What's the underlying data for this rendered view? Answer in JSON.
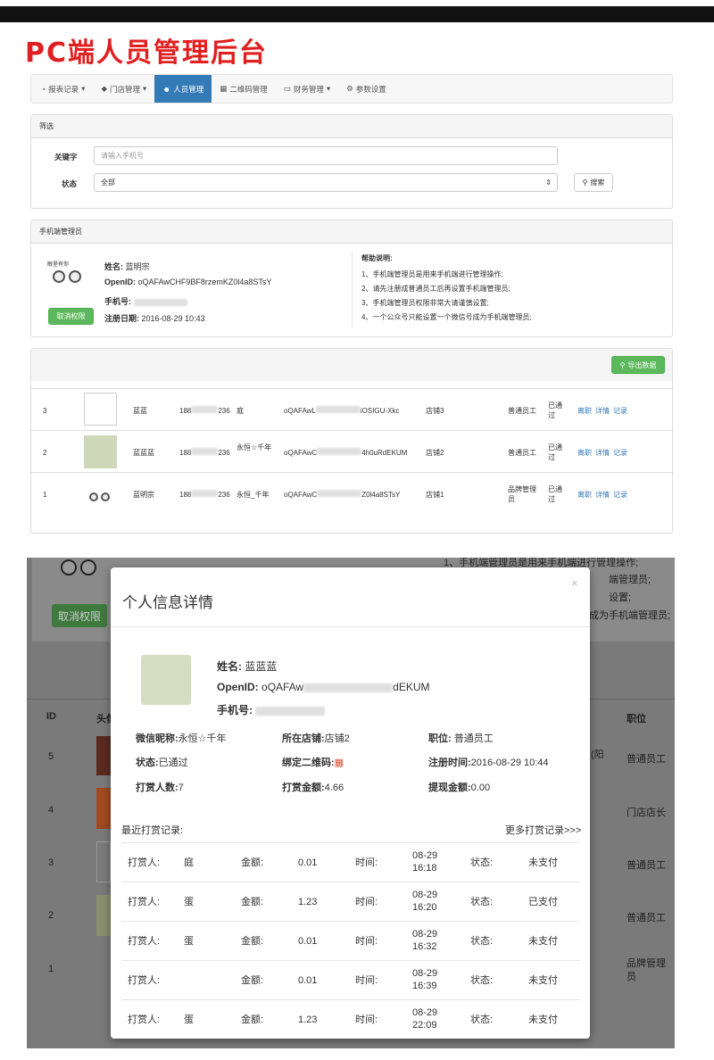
{
  "heading": "PC端人员管理后台",
  "nav": {
    "items": [
      {
        "label": "报表记录",
        "caret": "▾",
        "icon": "chart-icon"
      },
      {
        "label": "门店管理",
        "caret": "▾",
        "icon": "tag-icon"
      },
      {
        "label": "人员管理",
        "caret": "",
        "icon": "users-icon",
        "active": true
      },
      {
        "label": "二维码管理",
        "caret": "",
        "icon": "qrcode-icon"
      },
      {
        "label": "财务管理",
        "caret": "▾",
        "icon": "money-icon"
      },
      {
        "label": "参数设置",
        "caret": "",
        "icon": "gear-icon"
      }
    ]
  },
  "filter": {
    "title": "筛选",
    "keyword_label": "关键字",
    "keyword_placeholder": "请输入手机号",
    "status_label": "状态",
    "status_value": "全部",
    "search_button": "搜索"
  },
  "manager": {
    "title": "手机端管理员",
    "avatar_caption": "眼里有你",
    "cancel_button": "取消权限",
    "name_label": "姓名:",
    "name": "蓝明宗",
    "openid_label": "OpenID:",
    "openid": "oQAFAwCHF9BF8rzemKZ0l4a8STsY",
    "phone_label": "手机号:",
    "date_label": "注册日期:",
    "date": "2016-08-29 10:43",
    "help_title": "帮助说明:",
    "help": [
      "1、手机端管理员是用来手机端进行管理操作;",
      "2、请先注册成普通员工后再设置手机端管理员;",
      "3、手机端管理员权限非常大请谨慎设置;",
      "4、一个公众号只能设置一个微信号成为手机端管理员;"
    ]
  },
  "export_button": "导出数据",
  "rows": [
    {
      "id": "3",
      "name": "蓝蓝",
      "phone_a": "188",
      "phone_b": "236",
      "nick": "庭",
      "openid_a": "oQAFAwL",
      "openid_b": "iOSIGU-Xkc",
      "store": "店铺3",
      "role": "普通员工",
      "status": "已通过",
      "actions": [
        "离职",
        "详情",
        "记录"
      ]
    },
    {
      "id": "2",
      "name": "蓝蓝蓝",
      "phone_a": "188",
      "phone_b": "236",
      "nick": "永恒☆千年",
      "openid_a": "oQAFAwC",
      "openid_b": "4h0uRdEKUM",
      "store": "店铺2",
      "role": "普通员工",
      "status": "已通过",
      "actions": [
        "离职",
        "详情",
        "记录"
      ]
    },
    {
      "id": "1",
      "name": "蓝明宗",
      "phone_a": "188",
      "phone_b": "236",
      "nick": "永恒_千年",
      "openid_a": "oQAFAwC",
      "openid_b": "Z0l4a8STsY",
      "store": "店铺1",
      "role": "品牌管理员",
      "status": "已通过",
      "actions": [
        "离职",
        "详情",
        "记录"
      ]
    }
  ],
  "bg": {
    "help1": "1、手机端管理员是用来手机端进行管理操作;",
    "help2": "端管理员;",
    "help3": "设置;",
    "help4": "成为手机端管理员;",
    "cancel": "取消权限",
    "col_id": "ID",
    "col_head": "头像",
    "col_role": "职位",
    "park": "(阳",
    "ids": [
      "5",
      "4",
      "3",
      "2",
      "1"
    ],
    "roles": [
      "普通员工",
      "门店店长",
      "普通员工",
      "普通员工",
      "品牌管理员"
    ]
  },
  "modal": {
    "title": "个人信息详情",
    "close": "×",
    "name_label": "姓名:",
    "name": "蓝蓝蓝",
    "openid_label": "OpenID:",
    "openid_a": "oQAFAw",
    "openid_b": "dEKUM",
    "phone_label": "手机号:",
    "nick_label": "微信昵称:",
    "nick": "永恒☆千年",
    "store_label": "所在店铺:",
    "store": "店铺2",
    "role_label": "职位:",
    "role": "普通员工",
    "status_label": "状态:",
    "status": "已通过",
    "qr_label": "绑定二维码:",
    "regtime_label": "注册时间:",
    "regtime": "2016-08-29 10:44",
    "tips_count_label": "打赏人数:",
    "tips_count": "7",
    "tips_amount_label": "打赏金额:",
    "tips_amount": "4.66",
    "withdraw_label": "提现金额:",
    "withdraw": "0.00",
    "recent_label": "最近打赏记录:",
    "more_link": "更多打赏记录>>>",
    "records": [
      {
        "tipper_label": "打赏人:",
        "tipper": "庭",
        "amount_label": "金额:",
        "amount": "0.01",
        "time_label": "时间:",
        "date": "08-29",
        "time": "16:18",
        "status_label": "状态:",
        "status": "未支付"
      },
      {
        "tipper_label": "打赏人:",
        "tipper": "蛋",
        "amount_label": "金额:",
        "amount": "1.23",
        "time_label": "时间:",
        "date": "08-29",
        "time": "16:20",
        "status_label": "状态:",
        "status": "已支付"
      },
      {
        "tipper_label": "打赏人:",
        "tipper": "蛋",
        "amount_label": "金额:",
        "amount": "0.01",
        "time_label": "时间:",
        "date": "08-29",
        "time": "16:32",
        "status_label": "状态:",
        "status": "未支付"
      },
      {
        "tipper_label": "打赏人:",
        "tipper": "",
        "amount_label": "金额:",
        "amount": "0.01",
        "time_label": "时间:",
        "date": "08-29",
        "time": "16:39",
        "status_label": "状态:",
        "status": "未支付"
      },
      {
        "tipper_label": "打赏人:",
        "tipper": "蛋",
        "amount_label": "金额:",
        "amount": "1.23",
        "time_label": "时间:",
        "date": "08-29",
        "time": "22:09",
        "status_label": "状态:",
        "status": "未支付"
      }
    ]
  },
  "colors": {
    "accent": "#337ab7",
    "green": "#5cb85c",
    "heading": "#e02020"
  }
}
